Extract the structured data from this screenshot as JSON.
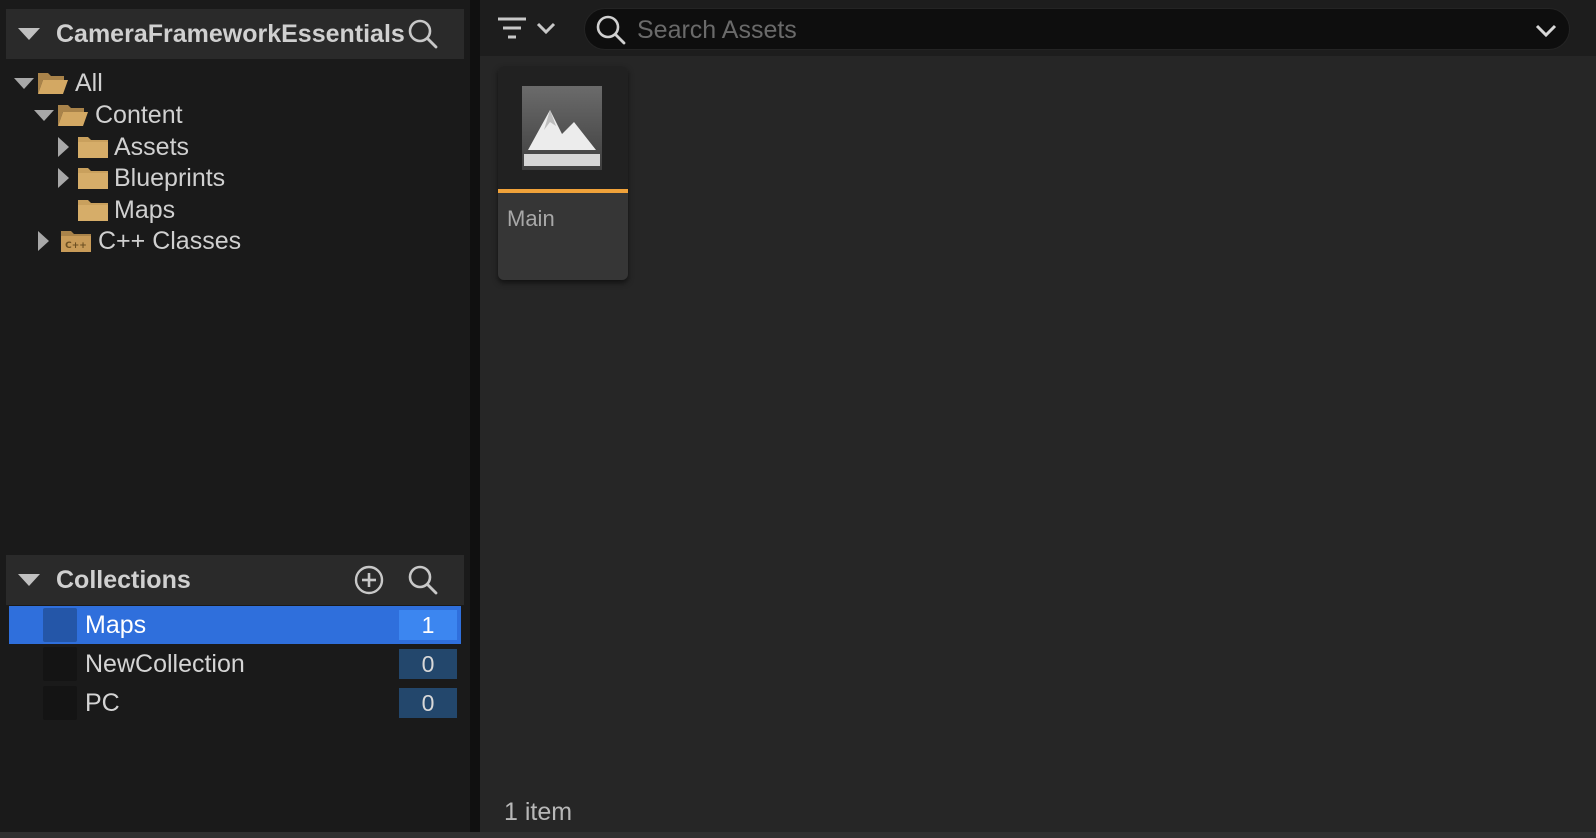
{
  "content_browser": {
    "source_tree": {
      "title": "CameraFrameworkEssentials",
      "nodes": [
        {
          "label": "All",
          "icon": "folder-open-icon",
          "expanded": true
        },
        {
          "label": "Content",
          "icon": "folder-open-icon",
          "expanded": true
        },
        {
          "label": "Assets",
          "icon": "folder-icon",
          "expanded": false
        },
        {
          "label": "Blueprints",
          "icon": "folder-icon",
          "expanded": false
        },
        {
          "label": "Maps",
          "icon": "folder-icon",
          "expanded": null
        },
        {
          "label": "C++ Classes",
          "icon": "cpp-folder-icon",
          "expanded": false
        }
      ]
    },
    "collections": {
      "title": "Collections",
      "items": [
        {
          "name": "Maps",
          "count": "1",
          "selected": true
        },
        {
          "name": "NewCollection",
          "count": "0",
          "selected": false
        },
        {
          "name": "PC",
          "count": "0",
          "selected": false
        }
      ]
    },
    "toolbar": {
      "search_placeholder": "Search Assets",
      "search_value": ""
    },
    "assets": [
      {
        "name": "Main",
        "type_icon": "level-map-icon",
        "type_color": "#f0a23a"
      }
    ],
    "status": "1 item"
  },
  "colors": {
    "selection": "#2f6fdc",
    "folder": "#c9a05d",
    "level_asset_accent": "#f0a23a",
    "count_badge": "#23476c"
  }
}
